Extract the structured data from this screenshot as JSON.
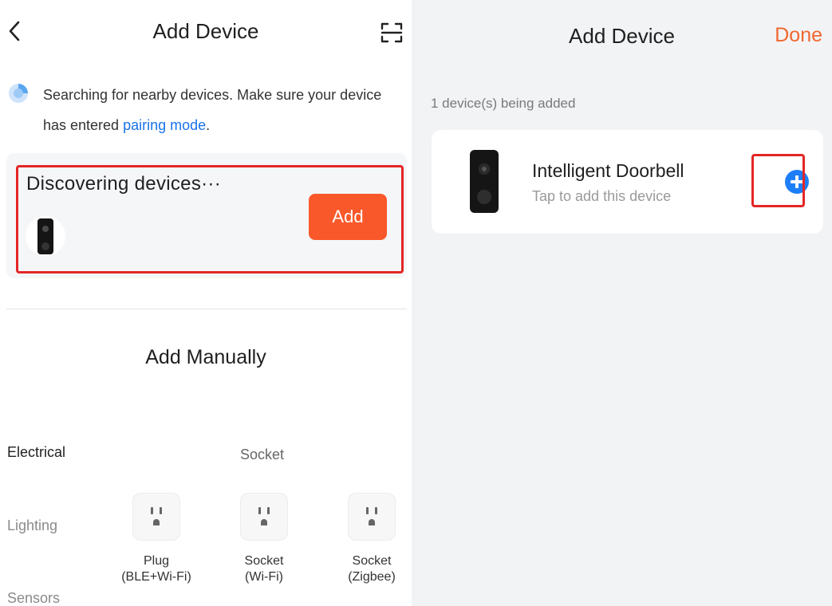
{
  "left": {
    "header": {
      "title": "Add Device",
      "back_icon": "chevron-left-icon",
      "scan_icon": "scan-icon"
    },
    "search": {
      "text_before": "Searching for nearby devices. Make sure your device has entered ",
      "link": "pairing mode",
      "text_after": ".",
      "link_color": "#1a73e8"
    },
    "discovering": {
      "title": "Discovering devices···",
      "add_label": "Add",
      "add_color": "#f9582b"
    },
    "manual": {
      "title": "Add Manually",
      "categories": [
        {
          "label": "Electrical",
          "active": true
        },
        {
          "label": "Lighting",
          "active": false
        },
        {
          "label": "Sensors",
          "active": false
        }
      ],
      "section_label": "Socket",
      "items": [
        {
          "line1": "Plug",
          "line2": "(BLE+Wi-Fi)"
        },
        {
          "line1": "Socket",
          "line2": "(Wi-Fi)"
        },
        {
          "line1": "Socket",
          "line2": "(Zigbee)"
        }
      ]
    }
  },
  "right": {
    "header": {
      "title": "Add Device",
      "done_label": "Done",
      "done_color": "#f0672f"
    },
    "count_text": "1 device(s) being added",
    "device": {
      "name": "Intelligent Doorbell",
      "subtitle": "Tap to add this device",
      "add_icon": "plus-circle-icon"
    }
  },
  "highlight_color": "#e32626"
}
